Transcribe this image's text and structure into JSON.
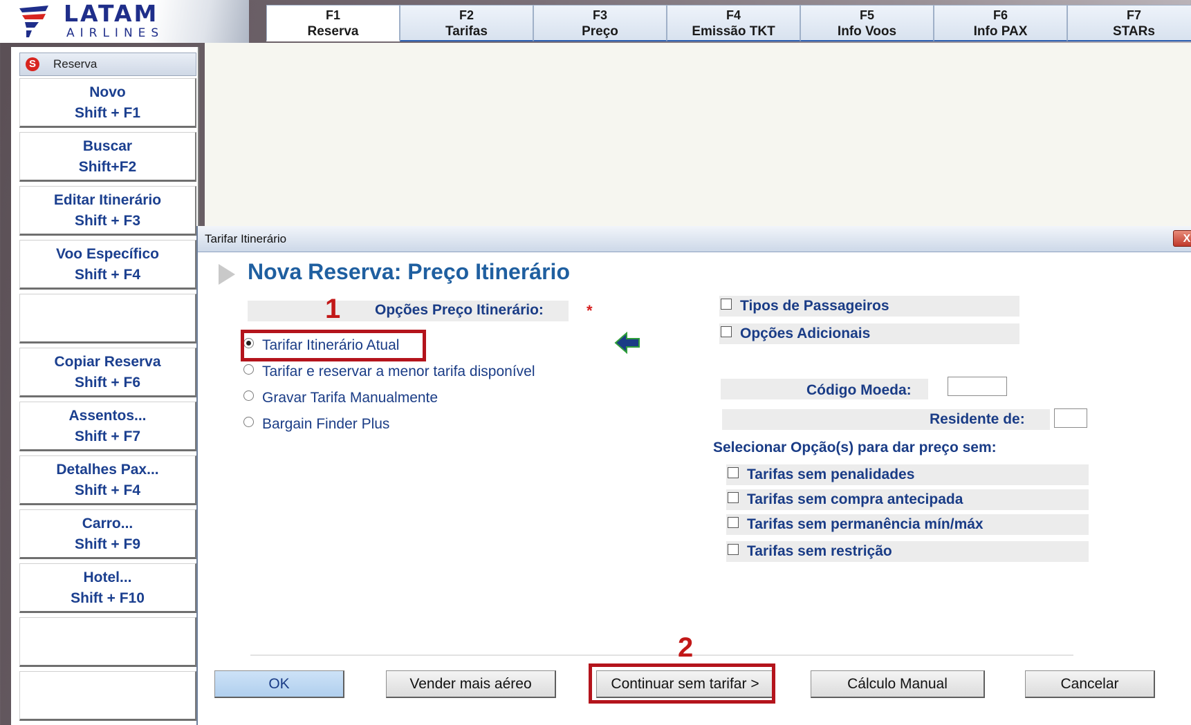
{
  "logo": {
    "top": "LATAM",
    "bottom": "AIRLINES"
  },
  "fkeys": [
    {
      "key": "F1",
      "label": "Reserva",
      "active": true
    },
    {
      "key": "F2",
      "label": "Tarifas"
    },
    {
      "key": "F3",
      "label": "Preço"
    },
    {
      "key": "F4",
      "label": "Emissão TKT"
    },
    {
      "key": "F5",
      "label": "Info Voos"
    },
    {
      "key": "F6",
      "label": "Info PAX"
    },
    {
      "key": "F7",
      "label": "STARs"
    }
  ],
  "sidebar": {
    "header": "Reserva",
    "header_icon": "S",
    "buttons": [
      {
        "title": "Novo",
        "shortcut": "Shift + F1"
      },
      {
        "title": "Buscar",
        "shortcut": "Shift+F2"
      },
      {
        "title": "Editar Itinerário",
        "shortcut": "Shift + F3"
      },
      {
        "title": "Voo Específico",
        "shortcut": "Shift + F4"
      },
      {
        "title": "",
        "shortcut": ""
      },
      {
        "title": "Copiar Reserva",
        "shortcut": "Shift + F6"
      },
      {
        "title": "Assentos...",
        "shortcut": "Shift + F7"
      },
      {
        "title": "Detalhes Pax...",
        "shortcut": "Shift + F4"
      },
      {
        "title": "Carro...",
        "shortcut": "Shift + F9"
      },
      {
        "title": "Hotel...",
        "shortcut": "Shift + F10"
      },
      {
        "title": "",
        "shortcut": ""
      },
      {
        "title": "",
        "shortcut": ""
      }
    ]
  },
  "dialog": {
    "title": "Tarifar Itinerário",
    "close": "X",
    "heading": "Nova Reserva: Preço Itinerário",
    "options_label": "Opções Preço Itinerário:",
    "required": "*",
    "radio_options": [
      {
        "label": "Tarifar Itinerário Atual",
        "checked": true
      },
      {
        "label": "Tarifar e reservar a menor tarifa disponível",
        "checked": false
      },
      {
        "label": "Gravar Tarifa Manualmente",
        "checked": false
      },
      {
        "label": "Bargain Finder Plus",
        "checked": false
      }
    ],
    "right_checks": [
      {
        "label": "Tipos de Passageiros",
        "checked": false
      },
      {
        "label": "Opções Adicionais",
        "checked": false
      }
    ],
    "currency_label": "Código Moeda:",
    "currency_value": "",
    "resident_label": "Residente de:",
    "resident_value": "",
    "select_label": "Selecionar Opção(s) para dar preço sem:",
    "fare_checks": [
      {
        "label": "Tarifas sem penalidades",
        "checked": false
      },
      {
        "label": "Tarifas sem compra antecipada",
        "checked": false
      },
      {
        "label": "Tarifas sem permanência mín/máx",
        "checked": false
      },
      {
        "label": "Tarifas sem restrição",
        "checked": false
      }
    ],
    "buttons": {
      "ok": "OK",
      "sell_more": "Vender mais aéreo",
      "continue": "Continuar sem tarifar >",
      "manual": "Cálculo Manual",
      "cancel": "Cancelar"
    }
  },
  "annotations": {
    "step1": "1",
    "step2": "2",
    "color": "#c21818"
  }
}
